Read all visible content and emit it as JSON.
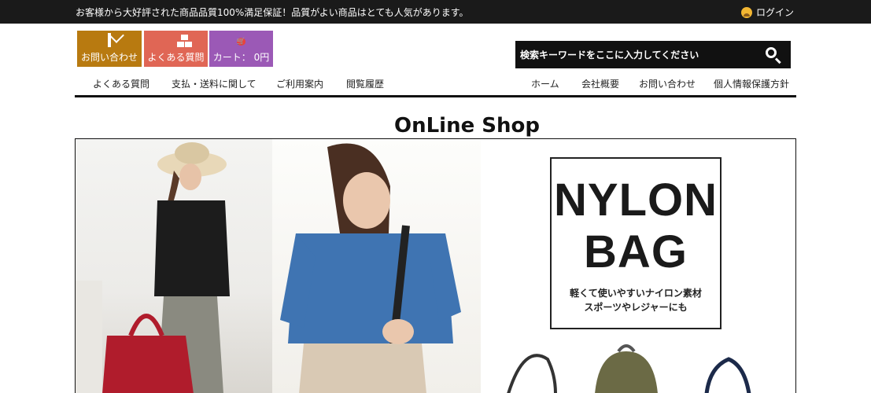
{
  "topbar": {
    "notice": "お客様から大好評された商品品質100%満足保証！品質がよい商品はとても人気があります。",
    "login": "ログイン"
  },
  "header": {
    "tiles": [
      {
        "label": "お問い合わせ",
        "color": "#b87a10",
        "icon": "mail-icon"
      },
      {
        "label": "よくある質問",
        "color": "#e06655",
        "icon": "boxes-icon"
      },
      {
        "label": "カート： 0円",
        "color": "#9b59b6",
        "icon": "cart-icon"
      }
    ],
    "search": {
      "placeholder": "検索キーワードをここに入力してください"
    }
  },
  "nav": {
    "left": [
      "よくある質問",
      "支払・送料に関して",
      "ご利用案内",
      "閲覧履歴"
    ],
    "right": [
      "ホーム",
      "会社概要",
      "お問い合わせ",
      "個人情報保護方針"
    ]
  },
  "page_title": "OnLine Shop",
  "banner": {
    "heading_line1": "NYLON",
    "heading_line2": "BAG",
    "sub_line1": "軽くて使いやすいナイロン素材",
    "sub_line2": "スポーツやレジャーにも"
  }
}
